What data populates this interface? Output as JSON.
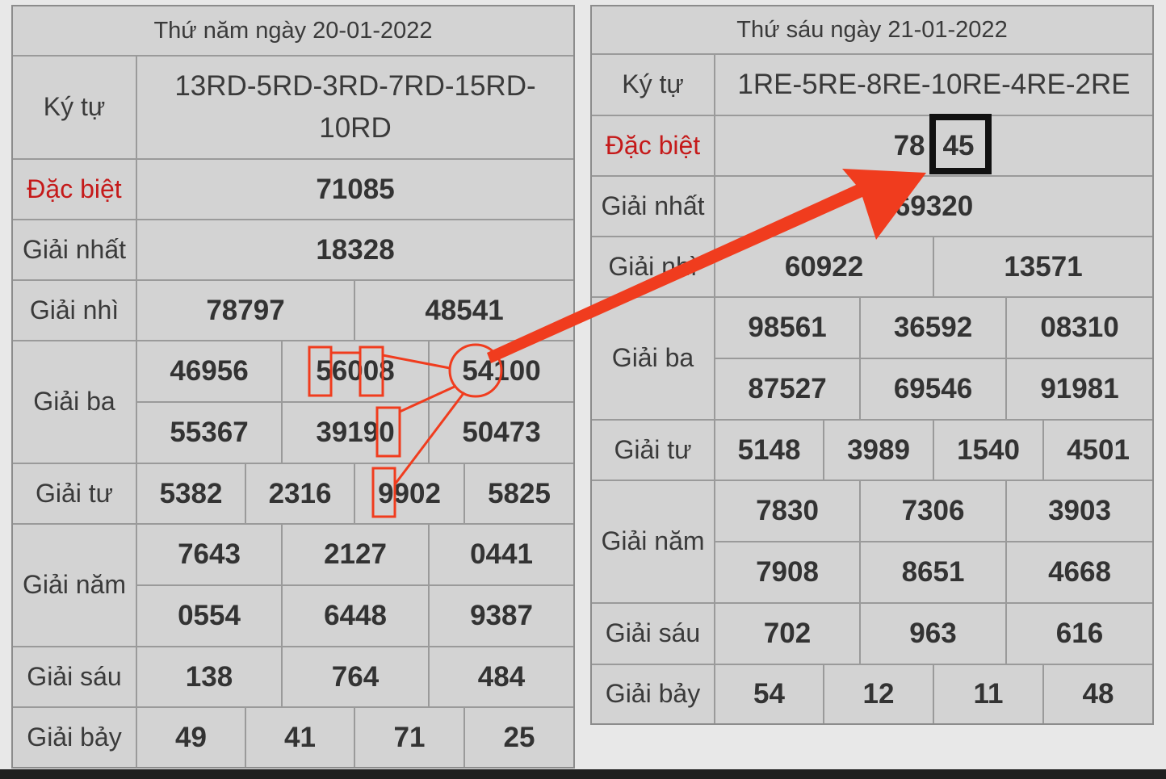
{
  "left": {
    "header": "Thứ năm ngày 20-01-2022",
    "ky_tu_label": "Ký tự",
    "ky_tu_value": "13RD-5RD-3RD-7RD-15RD-10RD",
    "dac_biet_label": "Đặc biệt",
    "dac_biet": "71085",
    "nhat_label": "Giải nhất",
    "nhat": "18328",
    "nhi_label": "Giải nhì",
    "nhi": [
      "78797",
      "48541"
    ],
    "ba_label": "Giải ba",
    "ba": [
      "46956",
      "56008",
      "54100",
      "55367",
      "39190",
      "50473"
    ],
    "tu_label": "Giải tư",
    "tu": [
      "5382",
      "2316",
      "9902",
      "5825"
    ],
    "nam_label": "Giải năm",
    "nam": [
      "7643",
      "2127",
      "0441",
      "0554",
      "6448",
      "9387"
    ],
    "sau_label": "Giải sáu",
    "sau": [
      "138",
      "764",
      "484"
    ],
    "bay_label": "Giải bảy",
    "bay": [
      "49",
      "41",
      "71",
      "25"
    ]
  },
  "right": {
    "header": "Thứ sáu ngày 21-01-2022",
    "ky_tu_label": "Ký tự",
    "ky_tu_value": "1RE-5RE-8RE-10RE-4RE-2RE",
    "dac_biet_label": "Đặc biệt",
    "dac_biet_prefix": "78",
    "dac_biet_highlight": "45",
    "nhat_label": "Giải nhất",
    "nhat": "69320",
    "nhi_label": "Giải nhì",
    "nhi": [
      "60922",
      "13571"
    ],
    "ba_label": "Giải ba",
    "ba": [
      "98561",
      "36592",
      "08310",
      "87527",
      "69546",
      "91981"
    ],
    "tu_label": "Giải tư",
    "tu": [
      "5148",
      "3989",
      "1540",
      "4501"
    ],
    "nam_label": "Giải năm",
    "nam": [
      "7830",
      "7306",
      "3903",
      "7908",
      "8651",
      "4668"
    ],
    "sau_label": "Giải sáu",
    "sau": [
      "702",
      "963",
      "616"
    ],
    "bay_label": "Giải bảy",
    "bay": [
      "54",
      "12",
      "11",
      "48"
    ]
  },
  "colors": {
    "red": "#c51a1a",
    "annotation": "#f03c1e",
    "highlight_box": "#111111"
  }
}
